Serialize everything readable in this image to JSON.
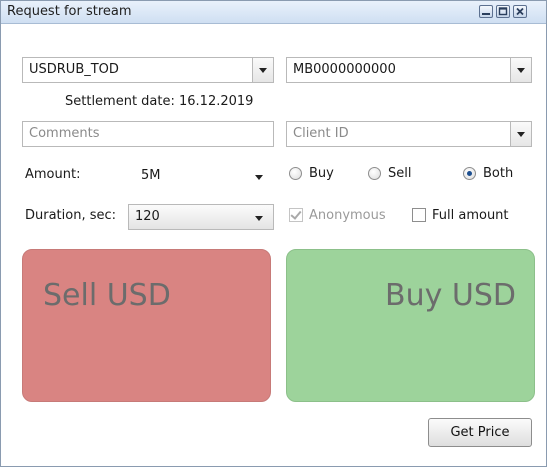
{
  "window": {
    "title": "Request for stream",
    "controls": {
      "minimize": "minimize-icon",
      "maximize": "maximize-icon",
      "close": "close-icon"
    }
  },
  "form": {
    "instrument": "USDRUB_TOD",
    "account": "MB0000000000",
    "settlement": "Settlement date: 16.12.2019",
    "comments_placeholder": "Comments",
    "client_placeholder": "Client ID",
    "amount_label": "Amount:",
    "amount_value": "5M",
    "duration_label": "Duration, sec:",
    "duration_value": "120",
    "side_options": [
      {
        "label": "Buy",
        "selected": false
      },
      {
        "label": "Sell",
        "selected": false
      },
      {
        "label": "Both",
        "selected": true
      }
    ],
    "anonymous": {
      "label": "Anonymous",
      "checked": true,
      "enabled": false
    },
    "full_amount": {
      "label": "Full amount",
      "checked": false
    }
  },
  "tiles": {
    "sell": {
      "label": "Sell USD",
      "color": "#d98482"
    },
    "buy": {
      "label": "Buy USD",
      "color": "#9dd39b"
    }
  },
  "actions": {
    "get_price": "Get Price"
  }
}
